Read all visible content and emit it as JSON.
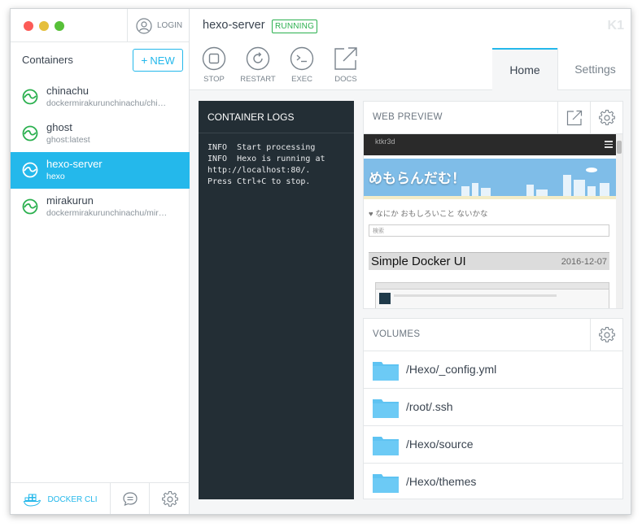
{
  "sidebar": {
    "login_label": "LOGIN",
    "containers_title": "Containers",
    "new_label": "NEW",
    "containers": [
      {
        "name": "chinachu",
        "image": "dockermirakurunchinachu/chinachu",
        "active": false
      },
      {
        "name": "ghost",
        "image": "ghost:latest",
        "active": false
      },
      {
        "name": "hexo-server",
        "image": "hexo",
        "active": true
      },
      {
        "name": "mirakurun",
        "image": "dockermirakurunchinachu/mirakurun",
        "active": false
      }
    ],
    "docker_cli_label": "DOCKER CLI"
  },
  "header": {
    "container_name": "hexo-server",
    "status": "RUNNING",
    "logo": "K1",
    "actions": {
      "stop": "STOP",
      "restart": "RESTART",
      "exec": "EXEC",
      "docs": "DOCS"
    },
    "tabs": {
      "home": "Home",
      "settings": "Settings"
    }
  },
  "logs": {
    "title": "CONTAINER LOGS",
    "text": "INFO  Start processing\nINFO  Hexo is running at\nhttp://localhost:80/.\nPress Ctrl+C to stop."
  },
  "web_preview": {
    "title": "WEB PREVIEW",
    "site_header": "ktkr3d",
    "banner_title": "めもらんだむ！",
    "subtitle": "♥ なにか おもしろいこと ないかな",
    "search_placeholder": "検索",
    "post_title": "Simple Docker UI",
    "post_date": "2016-12-07"
  },
  "volumes": {
    "title": "VOLUMES",
    "items": [
      "/Hexo/_config.yml",
      "/root/.ssh",
      "/Hexo/source",
      "/Hexo/themes"
    ]
  },
  "colors": {
    "accent": "#24b8eb",
    "running": "#2bb04f",
    "logs_bg": "#232e35",
    "folder": "#5ec3f2"
  }
}
